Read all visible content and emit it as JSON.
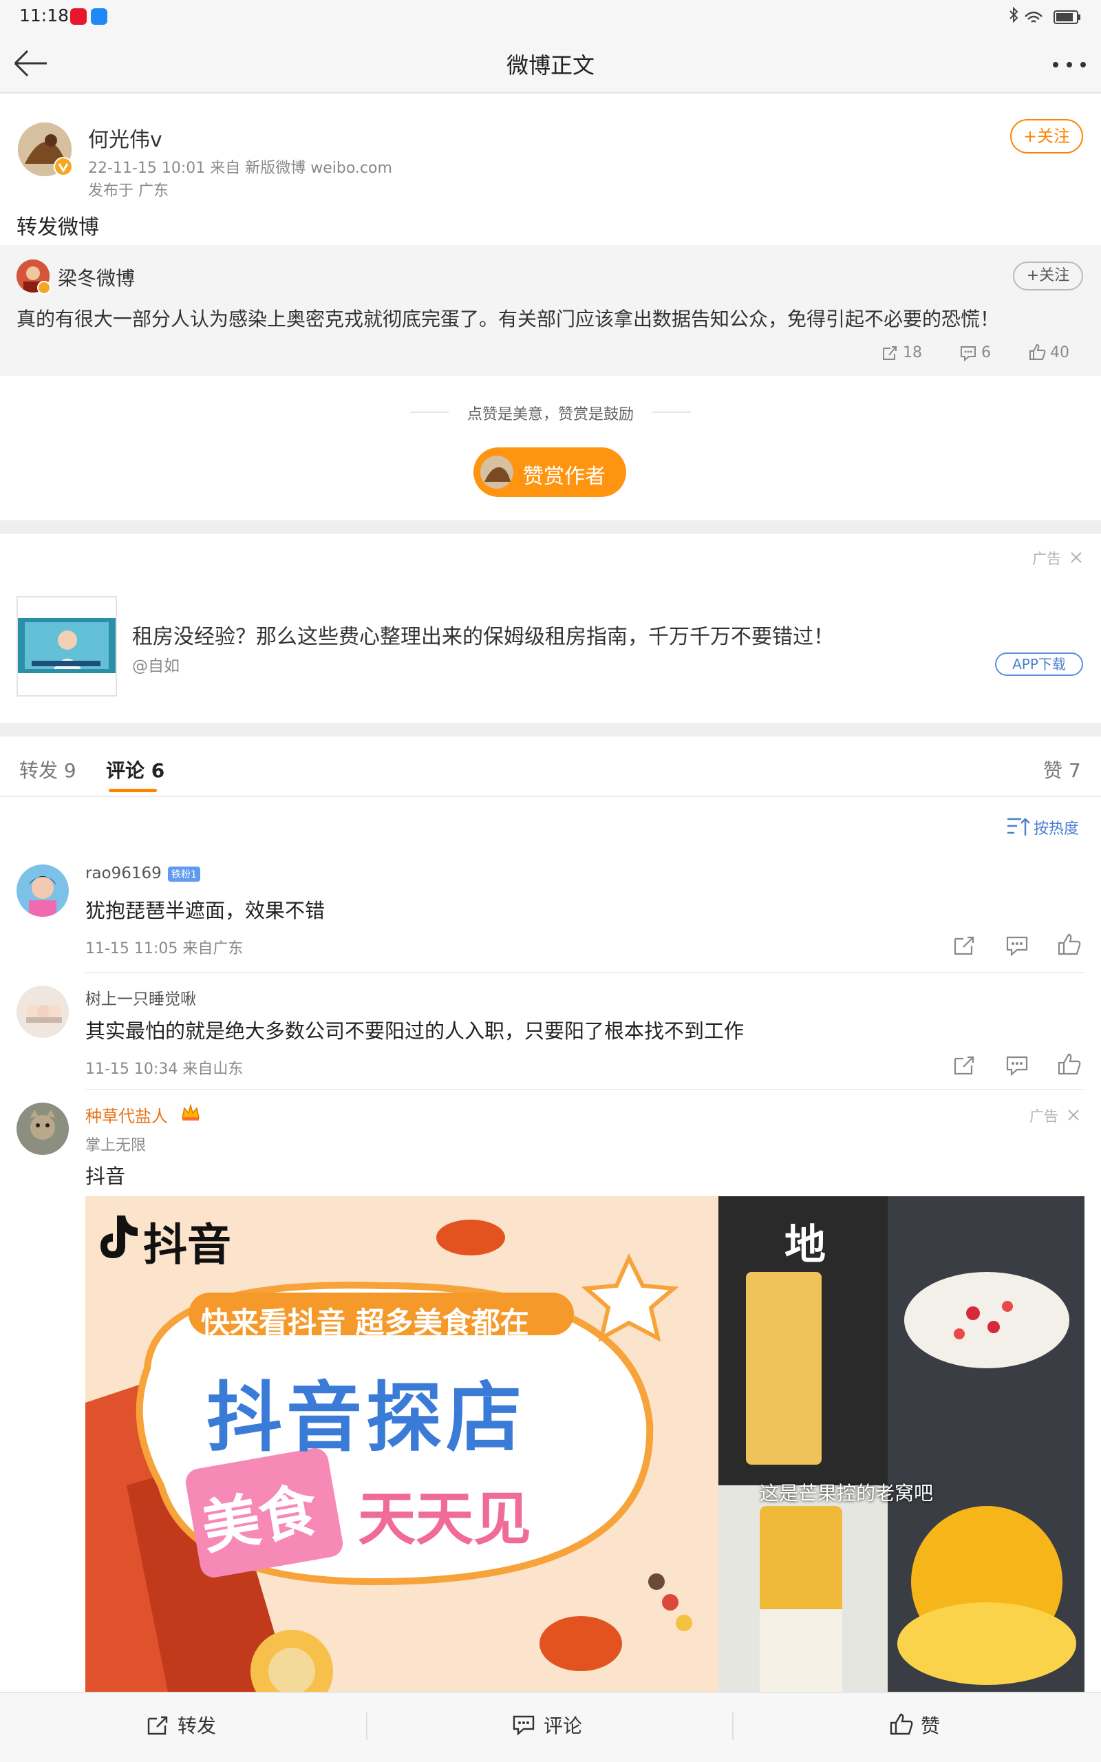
{
  "status_bar": {
    "time": "11:18"
  },
  "nav": {
    "title": "微博正文"
  },
  "post": {
    "author": "何光伟v",
    "meta_line": "22-11-15 10:01   来自 新版微博 weibo.com",
    "location": "发布于 广东",
    "follow_label": "+关注",
    "text": "转发微博"
  },
  "quoted": {
    "author": "梁冬微博",
    "follow_label": "+关注",
    "text": "真的有很大一部分人认为感染上奥密克戎就彻底完蛋了。有关部门应该拿出数据告知公众，免得引起不必要的恐慌！",
    "reposts": "18",
    "comments": "6",
    "likes": "40"
  },
  "reward": {
    "hint": "点赞是美意，赞赏是鼓励",
    "button": "赞赏作者"
  },
  "ad": {
    "label": "广告",
    "title": "租房没经验？那么这些费心整理出来的保姆级租房指南，千万千万不要错过！",
    "source": "@自如",
    "button": "APP下载"
  },
  "tabs": {
    "reposts": "转发 9",
    "comments": "评论 6",
    "likes": "赞 7"
  },
  "sort_label": "按热度",
  "comments": [
    {
      "name": "rao96169",
      "badge": "铁粉1",
      "text": "犹抱琵琶半遮面，效果不错",
      "meta": "11-15 11:05  来自广东"
    },
    {
      "name": "树上一只睡觉啾",
      "text": "其实最怕的就是绝大多数公司不要阳过的人入职，只要阳了根本找不到工作",
      "meta": "11-15 10:34  来自山东"
    }
  ],
  "ad_comment": {
    "name": "种草代盐人",
    "sub": "掌上无限",
    "label": "广告",
    "text": "抖音",
    "promo": {
      "brand": "抖音",
      "banner": "快来看抖音 超多美食都在",
      "headline": "抖音探店",
      "tag1": "美食",
      "tag2": "天天见",
      "corner": "地",
      "caption": "这是芒果控的老窝吧"
    }
  },
  "bottom": {
    "repost": "转发",
    "comment": "评论",
    "like": "赞"
  },
  "colors": {
    "accent": "#ff8200",
    "link": "#4a7fd0"
  }
}
